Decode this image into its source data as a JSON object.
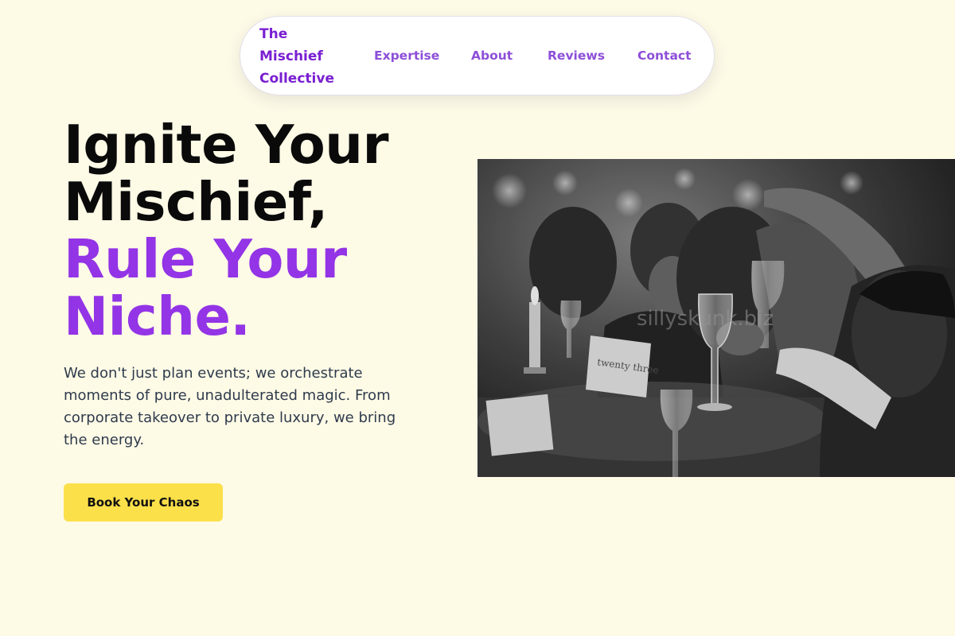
{
  "nav": {
    "brand": [
      "The",
      "Mischief",
      "Collective"
    ],
    "links": [
      "Expertise",
      "About",
      "Reviews",
      "Contact"
    ]
  },
  "hero": {
    "title_line1": "Ignite Your",
    "title_line2": "Mischief,",
    "title_line3": "Rule Your",
    "title_line4": "Niche.",
    "description": "We don't just plan events; we orchestrate moments of pure, unadulterated magic. From corporate takeover to private luxury, we bring the energy.",
    "cta_label": "Book Your Chaos"
  },
  "photo": {
    "watermark": "sillyskunk.biz",
    "card_text": "twenty three"
  },
  "colors": {
    "background": "#fdfae6",
    "brand": "#7a1fd1",
    "nav_link": "#8d4fd8",
    "accent": "#9334e6",
    "cta": "#fce04a"
  }
}
